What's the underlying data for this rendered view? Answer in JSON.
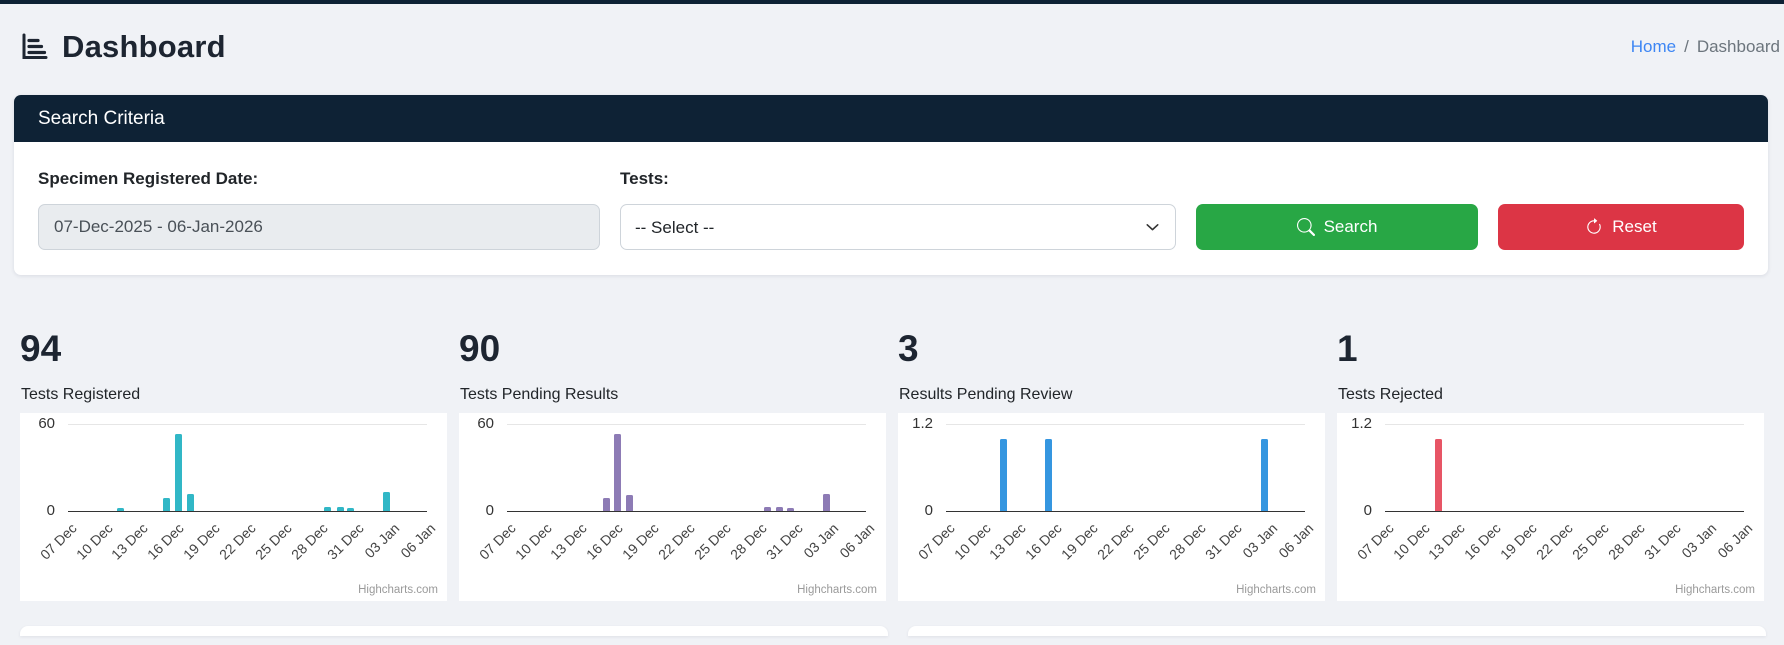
{
  "header": {
    "title": "Dashboard",
    "breadcrumb": {
      "home": "Home",
      "separator": "/",
      "current": "Dashboard"
    }
  },
  "search_panel": {
    "title": "Search Criteria",
    "date_label": "Specimen Registered Date:",
    "date_value": "07-Dec-2025 - 06-Jan-2026",
    "tests_label": "Tests:",
    "tests_value": "-- Select --",
    "search_button": "Search",
    "reset_button": "Reset",
    "colors": {
      "panel_header_bg": "#0e2235",
      "search_bg": "#28a745",
      "reset_bg": "#dc3545",
      "link_blue": "#3d86f4"
    }
  },
  "chart_data": [
    {
      "type": "bar",
      "big_number": "94",
      "title": "Tests Registered",
      "color": "#31b7c6",
      "ylim": [
        0,
        60
      ],
      "y_ticks": [
        "60",
        "0"
      ],
      "categories": [
        "07 Dec",
        "10 Dec",
        "13 Dec",
        "16 Dec",
        "19 Dec",
        "22 Dec",
        "25 Dec",
        "28 Dec",
        "31 Dec",
        "03 Jan",
        "06 Jan"
      ],
      "points": [
        {
          "date": "11 Dec",
          "pos": 4.4,
          "value": 2
        },
        {
          "date": "15 Dec",
          "pos": 8.2,
          "value": 9
        },
        {
          "date": "16 Dec",
          "pos": 9.2,
          "value": 53
        },
        {
          "date": "17 Dec",
          "pos": 10.2,
          "value": 12
        },
        {
          "date": "29 Dec",
          "pos": 21.7,
          "value": 3
        },
        {
          "date": "30 Dec",
          "pos": 22.8,
          "value": 3
        },
        {
          "date": "31 Dec",
          "pos": 23.6,
          "value": 2
        },
        {
          "date": "03 Jan",
          "pos": 26.6,
          "value": 13
        }
      ],
      "credits": "Highcharts.com"
    },
    {
      "type": "bar",
      "big_number": "90",
      "title": "Tests Pending Results",
      "color": "#8d7bb5",
      "ylim": [
        0,
        60
      ],
      "y_ticks": [
        "60",
        "0"
      ],
      "categories": [
        "07 Dec",
        "10 Dec",
        "13 Dec",
        "16 Dec",
        "19 Dec",
        "22 Dec",
        "25 Dec",
        "28 Dec",
        "31 Dec",
        "03 Jan",
        "06 Jan"
      ],
      "points": [
        {
          "date": "15 Dec",
          "pos": 8.3,
          "value": 9
        },
        {
          "date": "16 Dec",
          "pos": 9.25,
          "value": 53
        },
        {
          "date": "17 Dec",
          "pos": 10.2,
          "value": 11
        },
        {
          "date": "29 Dec",
          "pos": 21.8,
          "value": 3
        },
        {
          "date": "30 Dec",
          "pos": 22.75,
          "value": 3
        },
        {
          "date": "31 Dec",
          "pos": 23.7,
          "value": 2
        },
        {
          "date": "03 Jan",
          "pos": 26.7,
          "value": 12
        }
      ],
      "credits": "Highcharts.com"
    },
    {
      "type": "bar",
      "big_number": "3",
      "title": "Results Pending Review",
      "color": "#3596e0",
      "ylim": [
        0,
        1.2
      ],
      "y_ticks": [
        "1.2",
        "0"
      ],
      "categories": [
        "07 Dec",
        "10 Dec",
        "13 Dec",
        "16 Dec",
        "19 Dec",
        "22 Dec",
        "25 Dec",
        "28 Dec",
        "31 Dec",
        "03 Jan",
        "06 Jan"
      ],
      "points": [
        {
          "date": "12 Dec",
          "pos": 4.8,
          "value": 1
        },
        {
          "date": "16 Dec",
          "pos": 8.6,
          "value": 1
        },
        {
          "date": "03 Jan",
          "pos": 26.6,
          "value": 1
        }
      ],
      "credits": "Highcharts.com"
    },
    {
      "type": "bar",
      "big_number": "1",
      "title": "Tests Rejected",
      "color": "#e75565",
      "ylim": [
        0,
        1.2
      ],
      "y_ticks": [
        "1.2",
        "0"
      ],
      "categories": [
        "07 Dec",
        "10 Dec",
        "13 Dec",
        "16 Dec",
        "19 Dec",
        "22 Dec",
        "25 Dec",
        "28 Dec",
        "31 Dec",
        "03 Jan",
        "06 Jan"
      ],
      "points": [
        {
          "date": "12 Dec",
          "pos": 4.5,
          "value": 1
        }
      ],
      "credits": "Highcharts.com"
    }
  ]
}
